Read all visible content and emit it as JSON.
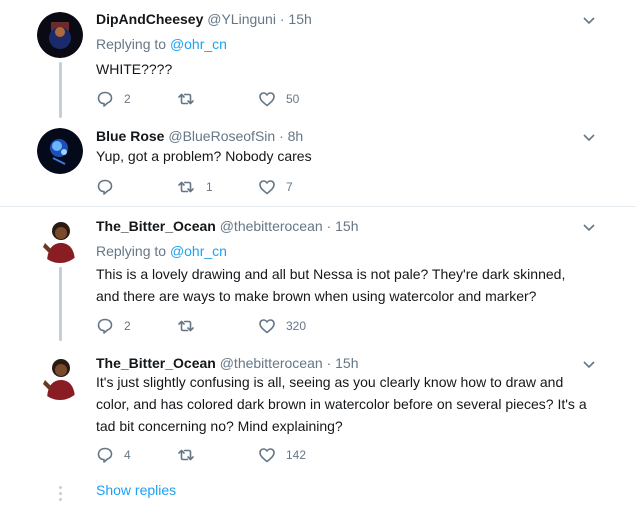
{
  "tweets": [
    {
      "name": "DipAndCheesey",
      "handle": "@YLinguni",
      "dot": "·",
      "time": "15h",
      "replying_prefix": "Replying to",
      "replying_to": "@ohr_cn",
      "text": "WHITE????",
      "reply_count": "2",
      "retweet_count": "",
      "like_count": "50"
    },
    {
      "name": "Blue Rose",
      "handle": "@BlueRoseofSin",
      "dot": "·",
      "time": "8h",
      "text": "Yup, got a problem? Nobody cares",
      "reply_count": "",
      "retweet_count": "1",
      "like_count": "7"
    },
    {
      "name": "The_Bitter_Ocean",
      "handle": "@thebitterocean",
      "dot": "·",
      "time": "15h",
      "replying_prefix": "Replying to",
      "replying_to": "@ohr_cn",
      "text_line1": "This is a lovely drawing and all but Nessa is not pale? They're dark skinned,",
      "text_line2": "and there are ways to make brown when using watercolor and marker?",
      "reply_count": "2",
      "retweet_count": "",
      "like_count": "320"
    },
    {
      "name": "The_Bitter_Ocean",
      "handle": "@thebitterocean",
      "dot": "·",
      "time": "15h",
      "text_line1": "It's just slightly confusing is all, seeing as you clearly know how to draw and",
      "text_line2": "color, and has colored dark brown in watercolor before on several pieces? It's a",
      "text_line3": "tad bit concerning no? Mind explaining?",
      "reply_count": "4",
      "retweet_count": "",
      "like_count": "142"
    }
  ],
  "show_replies_label": "Show replies",
  "colors": {
    "accent": "#1da1f2",
    "muted": "#657786",
    "divider": "#e6ecf0",
    "thread": "#c4cfd6"
  }
}
